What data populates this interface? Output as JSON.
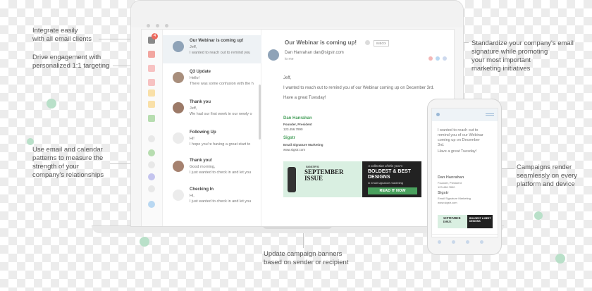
{
  "callouts": {
    "integrate": "Integrate easily\nwith all email clients",
    "drive": "Drive engagement with\npersonalized 1:1 targeting",
    "use": "Use email and calendar\npatterns to measure the\nstrength of your\ncompany's relationships",
    "standardize": "Standardize your company's email\nsignature while promoting\nyour most important\nmarketing initiatives",
    "campaigns": "Campaigns render\nseamlessly on every\nplatform and device",
    "update": "Update campaign banners\nbased on sender or recipient"
  },
  "inbox": {
    "badge_count": "4",
    "items": [
      {
        "title": "Our Webinar is coming up!",
        "line1": "Jeff,",
        "line2": "I wanted to reach out to remind you"
      },
      {
        "title": "Q3 Update",
        "line1": "Hello!",
        "line2": "There was some confusion with the h"
      },
      {
        "title": "Thank you",
        "line1": "Jeff,",
        "line2": "We had our first week in our newly o"
      },
      {
        "title": "Following Up",
        "line1": "Hi!",
        "line2": "I hope you're having a great start to"
      },
      {
        "title": "Thank you!",
        "line1": "Good morning,",
        "line2": "I just wanted to check in and let you"
      },
      {
        "title": "Checking In",
        "line1": "Hi,",
        "line2": "I just wanted to check in and let you"
      }
    ]
  },
  "message": {
    "subject": "Our Webinar is coming up!",
    "tag": "INBOX",
    "sender": "Dan Hanrahan dan@sigstr.com",
    "to": "to me",
    "greeting": "Jeff,",
    "body": "I wanted to reach out to remind you of our Webinar coming up on December 3rd.",
    "closing": "Have a great Tuesday!",
    "sig_name": "Dan Hanrahan",
    "sig_title": "Founder, President",
    "sig_phone": "123.456.7890",
    "sig_company": "Sigstr",
    "sig_tagline": "Email Signature Marketing",
    "sig_url": "www.sigstr.com"
  },
  "banner": {
    "brand": "SIGSTR'S",
    "title": "SEPTEMBER ISSUE",
    "subtitle": "A collection of this year's",
    "headline": "BOLDEST & BEST DESIGNS",
    "tail": "in email signature marketing",
    "cta": "READ IT NOW"
  },
  "phone": {
    "line1": "I wanted to reach out to",
    "line2": "remind you of our Webinar",
    "line3": "coming up on December",
    "line4": "3rd.",
    "closing": "Have a great Tuesday!",
    "sig_name": "Dan Hanrahan",
    "sig_title": "Founder, President",
    "sig_phone": "123.456.7890",
    "sig_company": "Sigstr",
    "sig_tagline": "Email Signature Marketing",
    "sig_url": "www.sigstr.com",
    "banner_title": "SEPTEMBER ISSUE",
    "banner_headline": "BOLDEST & BEST DESIGNS"
  },
  "colors": {
    "accent_green": "#4aa15e",
    "badge_red": "#ec6a5e",
    "rail_chips": [
      "#f2a6a0",
      "#f7c2c2",
      "#f9e0a8",
      "#cfe3c4",
      "#b7ddb0",
      "#c4c4ee",
      "#b9d8f2"
    ]
  }
}
